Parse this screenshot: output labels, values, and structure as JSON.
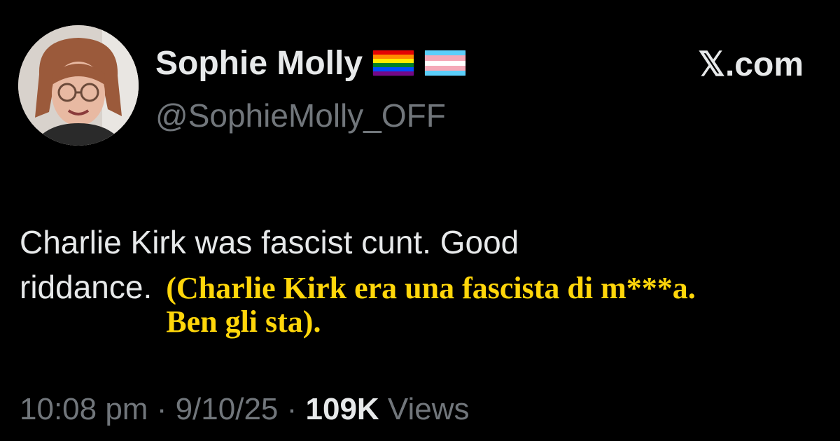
{
  "author": {
    "display_name": "Sophie Molly",
    "handle": "@SophieMolly_OFF",
    "badges": [
      "rainbow-flag-icon",
      "transgender-flag-icon"
    ]
  },
  "brand": {
    "label": "𝕏.com"
  },
  "tweet": {
    "text_line1": "Charlie Kirk was fascist cunt. Good",
    "text_line2": "riddance.",
    "translation_line1": "(Charlie Kirk era una fascista di m***a.",
    "translation_line2": "Ben gli sta)."
  },
  "meta": {
    "time": "10:08 pm",
    "separator": " · ",
    "date": "9/10/25",
    "views_count": "109K",
    "views_label": " Views"
  },
  "colors": {
    "background": "#000000",
    "primary_text": "#e7e9ea",
    "secondary_text": "#71767b",
    "translation_text": "#ffd60a"
  }
}
